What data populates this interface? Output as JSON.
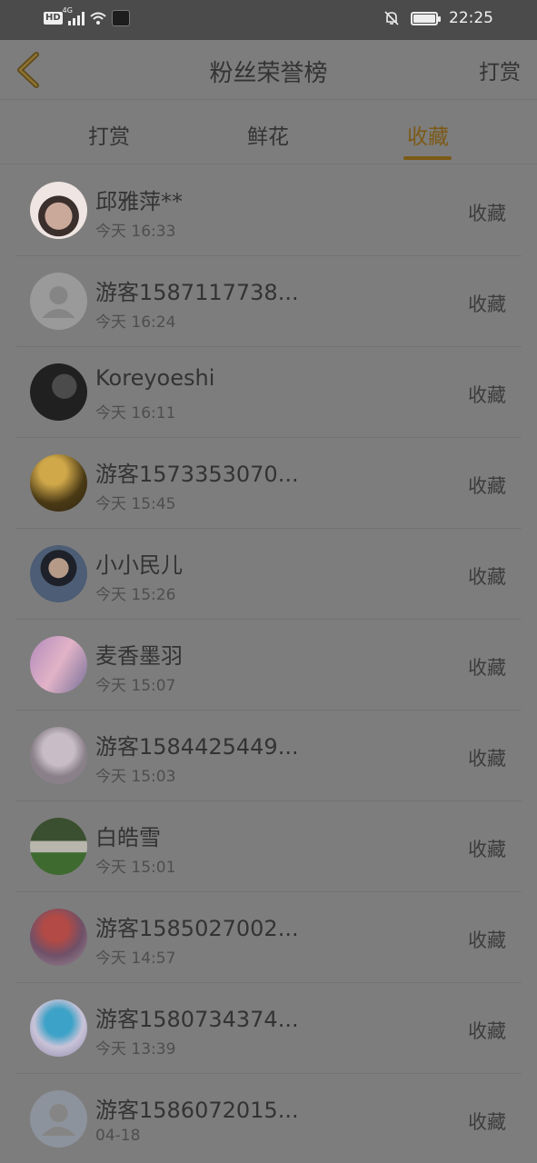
{
  "status_bar": {
    "hd_badge": "HD",
    "network": "4G",
    "time": "22:25"
  },
  "header": {
    "title": "粉丝荣誉榜",
    "action_label": "打赏"
  },
  "tabs": [
    {
      "label": "打赏",
      "active": false
    },
    {
      "label": "鲜花",
      "active": false
    },
    {
      "label": "收藏",
      "active": true
    }
  ],
  "accent_color": "#7c5a16",
  "fans": [
    {
      "name": "邱雅萍**",
      "time": "今天 16:33",
      "action": "收藏",
      "avatar": "photo-avatar"
    },
    {
      "name": "游客1587117738...",
      "time": "今天 16:24",
      "action": "收藏",
      "avatar": "default-user-icon"
    },
    {
      "name": "Koreyoeshi",
      "time": "今天 16:11",
      "action": "收藏",
      "avatar": "photo-avatar"
    },
    {
      "name": "游客1573353070...",
      "time": "今天 15:45",
      "action": "收藏",
      "avatar": "photo-avatar"
    },
    {
      "name": "小小民儿",
      "time": "今天 15:26",
      "action": "收藏",
      "avatar": "photo-avatar"
    },
    {
      "name": "麦香墨羽",
      "time": "今天 15:07",
      "action": "收藏",
      "avatar": "photo-avatar"
    },
    {
      "name": "游客1584425449...",
      "time": "今天 15:03",
      "action": "收藏",
      "avatar": "photo-avatar"
    },
    {
      "name": "白皓雪",
      "time": "今天 15:01",
      "action": "收藏",
      "avatar": "photo-avatar"
    },
    {
      "name": "游客1585027002...",
      "time": "今天 14:57",
      "action": "收藏",
      "avatar": "photo-avatar"
    },
    {
      "name": "游客1580734374...",
      "time": "今天 13:39",
      "action": "收藏",
      "avatar": "photo-avatar"
    },
    {
      "name": "游客1586072015...",
      "time": "04-18",
      "action": "收藏",
      "avatar": "default-user-icon"
    }
  ]
}
